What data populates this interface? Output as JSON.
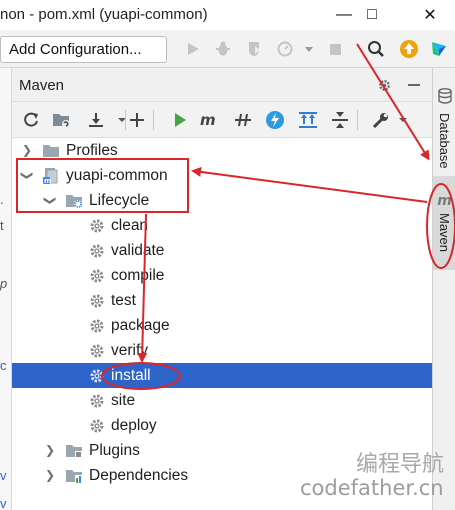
{
  "window": {
    "title": "non - pom.xml (yuapi-common)",
    "minimize_glyph": "—",
    "maximize_glyph": "□",
    "close_glyph": "✕"
  },
  "toolbar": {
    "add_configuration_label": "Add Configuration...",
    "icons": [
      "run-icon",
      "debug-icon",
      "coverage-icon",
      "profile-icon",
      "run-dropdown-icon",
      "stop-icon",
      "search-icon",
      "update-icon",
      "toolbox-icon"
    ]
  },
  "gutter": {
    "chars": [
      ". ",
      "t",
      "p",
      "c",
      "v",
      "v"
    ]
  },
  "maven_panel": {
    "title": "Maven",
    "header_icons": [
      "gear-icon",
      "minimize-icon"
    ],
    "toolbar_icons": [
      "reload-icon",
      "reimport-folder-icon",
      "download-icon",
      "add-icon",
      "run-maven-icon",
      "maven-goal-icon",
      "toggle-offline-icon",
      "skip-tests-icon",
      "show-dependencies-icon",
      "collapse-all-icon",
      "settings-wrench-icon"
    ]
  },
  "tree": {
    "profiles": "Profiles",
    "project": "yuapi-common",
    "lifecycle": "Lifecycle",
    "phases": [
      "clean",
      "validate",
      "compile",
      "test",
      "package",
      "verify",
      "install",
      "site",
      "deploy"
    ],
    "selected_phase": "install",
    "plugins": "Plugins",
    "dependencies": "Dependencies"
  },
  "side_tabs": {
    "database": "Database",
    "maven": "Maven",
    "maven_logo": "m"
  },
  "watermark": {
    "line1": "编程导航",
    "line2": "codefather.cn"
  },
  "colors": {
    "selection": "#2f65ca",
    "annotation": "#d9262a",
    "run_green": "#4aa047",
    "gear_gray": "#8c8c8c",
    "folder_gray": "#9aa7b0",
    "update_orange": "#f0a30a"
  }
}
